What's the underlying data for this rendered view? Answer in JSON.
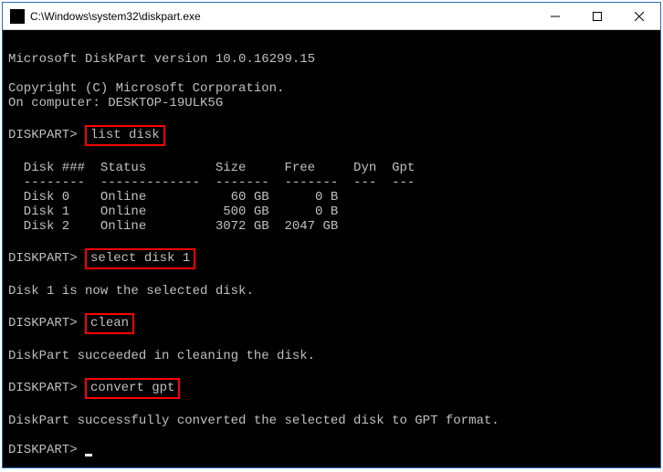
{
  "window": {
    "title": "C:\\Windows\\system32\\diskpart.exe"
  },
  "console": {
    "version_line": "Microsoft DiskPart version 10.0.16299.15",
    "copyright": "Copyright (C) Microsoft Corporation.",
    "computer_line": "On computer: DESKTOP-19ULK5G",
    "prompt": "DISKPART>",
    "cmd1": "list disk",
    "table_header": "  Disk ###  Status         Size     Free     Dyn  Gpt",
    "table_sep": "  --------  -------------  -------  -------  ---  ---",
    "disks": [
      "  Disk 0    Online           60 GB      0 B",
      "  Disk 1    Online          500 GB      0 B",
      "  Disk 2    Online         3072 GB  2047 GB"
    ],
    "cmd2": "select disk 1",
    "msg_select": "Disk 1 is now the selected disk.",
    "cmd3": "clean",
    "msg_clean": "DiskPart succeeded in cleaning the disk.",
    "cmd4": "convert gpt",
    "msg_convert": "DiskPart successfully converted the selected disk to GPT format."
  },
  "colors": {
    "highlight_border": "#ff0000",
    "window_border": "#2a6bbf",
    "console_bg": "#000000",
    "console_fg": "#c0c0c0"
  }
}
